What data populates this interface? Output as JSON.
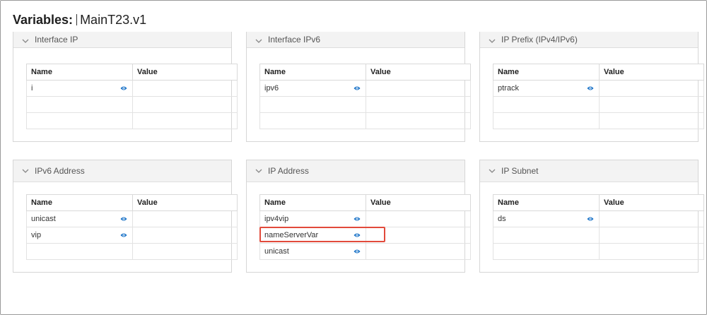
{
  "header": {
    "label": "Variables:",
    "name": "MainT23.v1"
  },
  "columns": {
    "name": "Name",
    "value": "Value"
  },
  "panels": [
    {
      "title": "Interface IP",
      "rows": [
        "i",
        "",
        ""
      ]
    },
    {
      "title": "Interface IPv6",
      "rows": [
        "ipv6",
        "",
        ""
      ]
    },
    {
      "title": "IP Prefix (IPv4/IPv6)",
      "rows": [
        "ptrack",
        "",
        ""
      ]
    },
    {
      "title": "IPv6 Address",
      "rows": [
        "unicast",
        "vip",
        ""
      ]
    },
    {
      "title": "IP Address",
      "rows": [
        "ipv4vip",
        "nameServerVar",
        "unicast"
      ]
    },
    {
      "title": "IP Subnet",
      "rows": [
        "ds",
        "",
        ""
      ]
    }
  ],
  "highlight": {
    "color": "#e24a3b",
    "target": "nameServerVar"
  },
  "colors": {
    "eye": "#1a73c8",
    "highlight": "#e24a3b"
  }
}
